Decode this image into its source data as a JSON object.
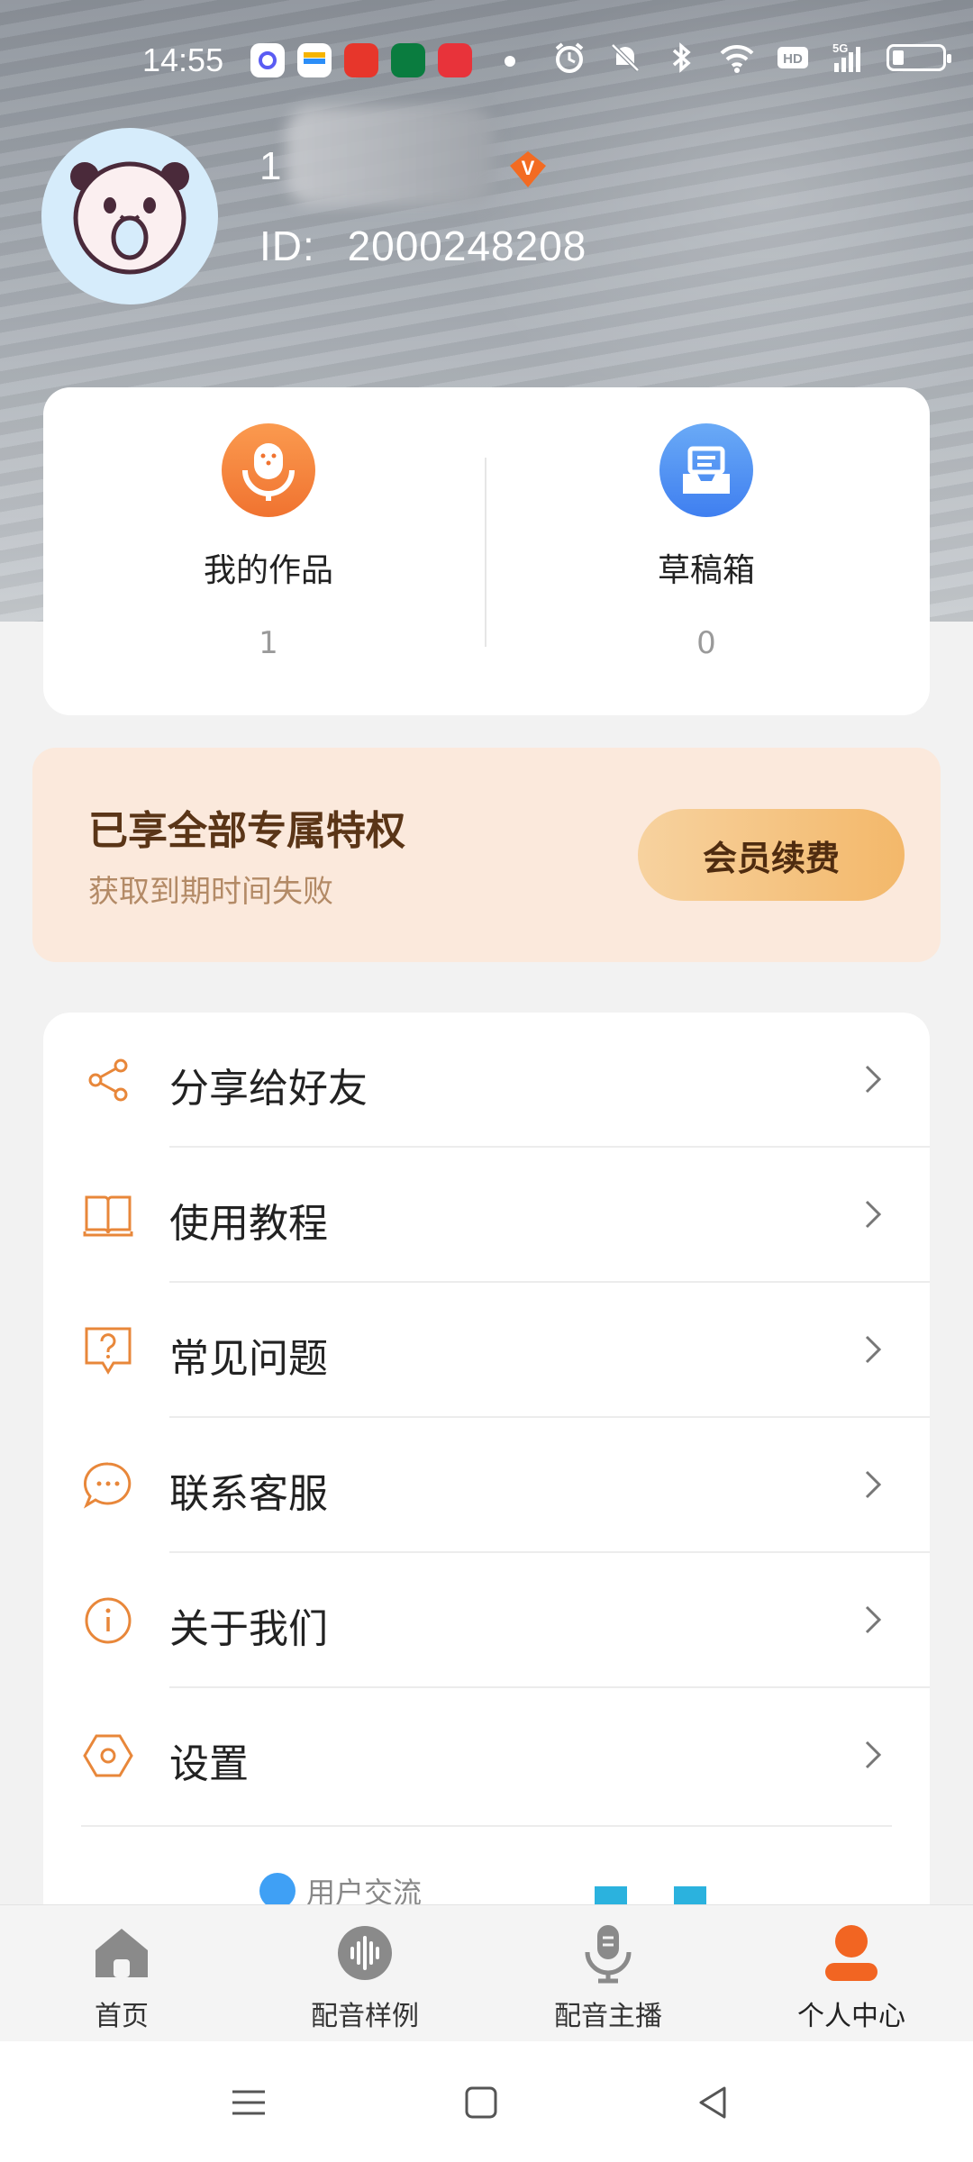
{
  "status_bar": {
    "time": "14:55",
    "app_icons": [
      "quark-app-icon",
      "wallet-app-icon",
      "shopping-app-icon",
      "oppo-app-icon",
      "toutiao-app-icon"
    ],
    "indicators": [
      "alarm-icon",
      "mute-icon",
      "bluetooth-icon",
      "wifi-icon",
      "hd-icon",
      "signal-5g-icon",
      "battery-icon"
    ]
  },
  "profile": {
    "username_visible": "1",
    "id_label": "ID:",
    "id_value": "2000248208",
    "vip_badge": "V"
  },
  "works": {
    "items": [
      {
        "label": "我的作品",
        "count": "1",
        "icon": "microphone-icon",
        "color": "#f5813a"
      },
      {
        "label": "草稿箱",
        "count": "0",
        "icon": "inbox-icon",
        "color": "#4d8df2"
      }
    ]
  },
  "vip": {
    "title": "已享全部专属特权",
    "subtitle": "获取到期时间失败",
    "button": "会员续费"
  },
  "menu": {
    "items": [
      {
        "label": "分享给好友",
        "icon": "share-icon"
      },
      {
        "label": "使用教程",
        "icon": "book-icon"
      },
      {
        "label": "常见问题",
        "icon": "question-icon"
      },
      {
        "label": "联系客服",
        "icon": "chat-icon"
      },
      {
        "label": "关于我们",
        "icon": "info-icon"
      },
      {
        "label": "设置",
        "icon": "settings-hex-icon"
      }
    ],
    "partial_label": "用户交流"
  },
  "tabs": {
    "items": [
      {
        "label": "首页",
        "icon": "home-icon"
      },
      {
        "label": "配音样例",
        "icon": "waveform-icon"
      },
      {
        "label": "配音主播",
        "icon": "anchor-mic-icon"
      },
      {
        "label": "个人中心",
        "icon": "person-icon"
      }
    ],
    "active_color": "#f26522",
    "inactive_color": "#8a8a8a"
  },
  "accent_color": "#e8873a"
}
